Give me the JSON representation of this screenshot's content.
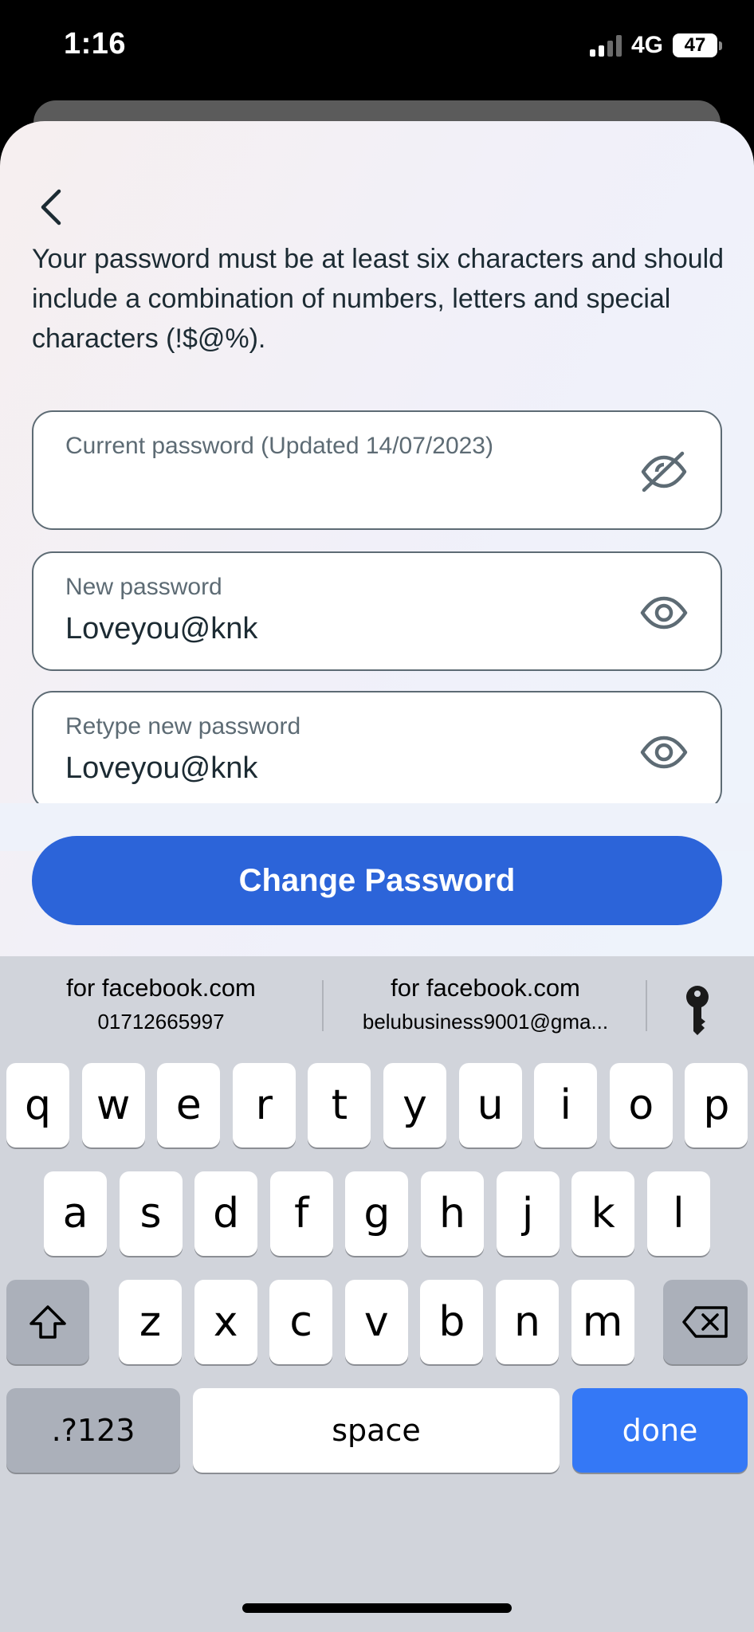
{
  "status_bar": {
    "time": "1:16",
    "network": "4G",
    "battery": "47"
  },
  "header": {
    "back_icon": "chevron-left-icon"
  },
  "description": "Your password must be at least six characters and should include a combination of numbers, letters and special characters (!$@%).",
  "fields": {
    "current": {
      "label": "Current password (Updated 14/07/2023)",
      "value": "",
      "icon": "eye-off-icon"
    },
    "new": {
      "label": "New password",
      "value": "Loveyou@knk",
      "icon": "eye-icon"
    },
    "retype": {
      "label": "Retype new password",
      "value": "Loveyou@knk",
      "icon": "eye-icon"
    }
  },
  "submit_label": "Change Password",
  "keyboard": {
    "suggestions": [
      {
        "title": "for facebook.com",
        "detail": "01712665997"
      },
      {
        "title": "for facebook.com",
        "detail": "belubusiness9001@gma..."
      }
    ],
    "row1": [
      "q",
      "w",
      "e",
      "r",
      "t",
      "y",
      "u",
      "i",
      "o",
      "p"
    ],
    "row2": [
      "a",
      "s",
      "d",
      "f",
      "g",
      "h",
      "j",
      "k",
      "l"
    ],
    "row3": [
      "z",
      "x",
      "c",
      "v",
      "b",
      "n",
      "m"
    ],
    "numbers_label": ".?123",
    "space_label": "space",
    "done_label": "done"
  },
  "colors": {
    "accent": "#2c64d9",
    "done_key": "#3478f6",
    "text": "#1c2b33"
  }
}
